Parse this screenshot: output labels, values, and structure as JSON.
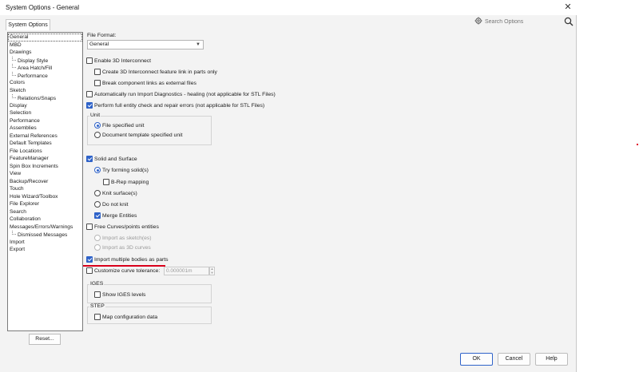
{
  "window": {
    "title": "System Options - General",
    "close_glyph": "✕"
  },
  "tab": {
    "label": "System Options"
  },
  "search": {
    "placeholder": "Search Options"
  },
  "tree": {
    "items": [
      {
        "label": "General",
        "child": false,
        "selected": true
      },
      {
        "label": "MBD",
        "child": false
      },
      {
        "label": "Drawings",
        "child": false
      },
      {
        "label": "Display Style",
        "child": true
      },
      {
        "label": "Area Hatch/Fill",
        "child": true
      },
      {
        "label": "Performance",
        "child": true
      },
      {
        "label": "Colors",
        "child": false
      },
      {
        "label": "Sketch",
        "child": false
      },
      {
        "label": "Relations/Snaps",
        "child": true
      },
      {
        "label": "Display",
        "child": false
      },
      {
        "label": "Selection",
        "child": false
      },
      {
        "label": "Performance",
        "child": false
      },
      {
        "label": "Assemblies",
        "child": false
      },
      {
        "label": "External References",
        "child": false
      },
      {
        "label": "Default Templates",
        "child": false
      },
      {
        "label": "File Locations",
        "child": false
      },
      {
        "label": "FeatureManager",
        "child": false
      },
      {
        "label": "Spin Box Increments",
        "child": false
      },
      {
        "label": "View",
        "child": false
      },
      {
        "label": "Backup/Recover",
        "child": false
      },
      {
        "label": "Touch",
        "child": false
      },
      {
        "label": "Hole Wizard/Toolbox",
        "child": false
      },
      {
        "label": "File Explorer",
        "child": false
      },
      {
        "label": "Search",
        "child": false
      },
      {
        "label": "Collaboration",
        "child": false
      },
      {
        "label": "Messages/Errors/Warnings",
        "child": false
      },
      {
        "label": "Dismissed Messages",
        "child": true
      },
      {
        "label": "Import",
        "child": false
      },
      {
        "label": "Export",
        "child": false
      }
    ],
    "reset_label": "Reset..."
  },
  "file_format": {
    "label": "File Format:",
    "value": "General"
  },
  "options": {
    "enable_3d": "Enable 3D Interconnect",
    "create_3d_link": "Create 3D Interconnect feature link in parts only",
    "break_links": "Break component links as external files",
    "auto_import_diag": "Automatically run Import Diagnostics - healing (not applicable for STL Files)",
    "full_entity_check": "Perform full entity check and repair errors (not applicable for STL Files)",
    "unit_group": "Unit",
    "unit_file": "File specified unit",
    "unit_template": "Document template specified unit",
    "solid_surface": "Solid and Surface",
    "try_forming": "Try forming solid(s)",
    "brep_mapping": "B-Rep mapping",
    "knit_surfaces": "Knit surface(s)",
    "do_not_knit": "Do not knit",
    "merge_entities": "Merge Entities",
    "free_curves": "Free Curves/points entities",
    "import_sketch": "Import as sketch(es)",
    "import_3d_curves": "Import as 3D curves",
    "import_multi_bodies": "Import multiple bodies as parts",
    "customize_tolerance": "Customize curve tolerance:",
    "tolerance_value": "0.000001m",
    "iges_group": "IGES",
    "show_iges_levels": "Show IGES levels",
    "step_group": "STEP",
    "map_config": "Map configuration data"
  },
  "buttons": {
    "ok": "OK",
    "cancel": "Cancel",
    "help": "Help"
  },
  "colors": {
    "accent": "#2f63c9",
    "annotation_underline": "#d9001b"
  }
}
